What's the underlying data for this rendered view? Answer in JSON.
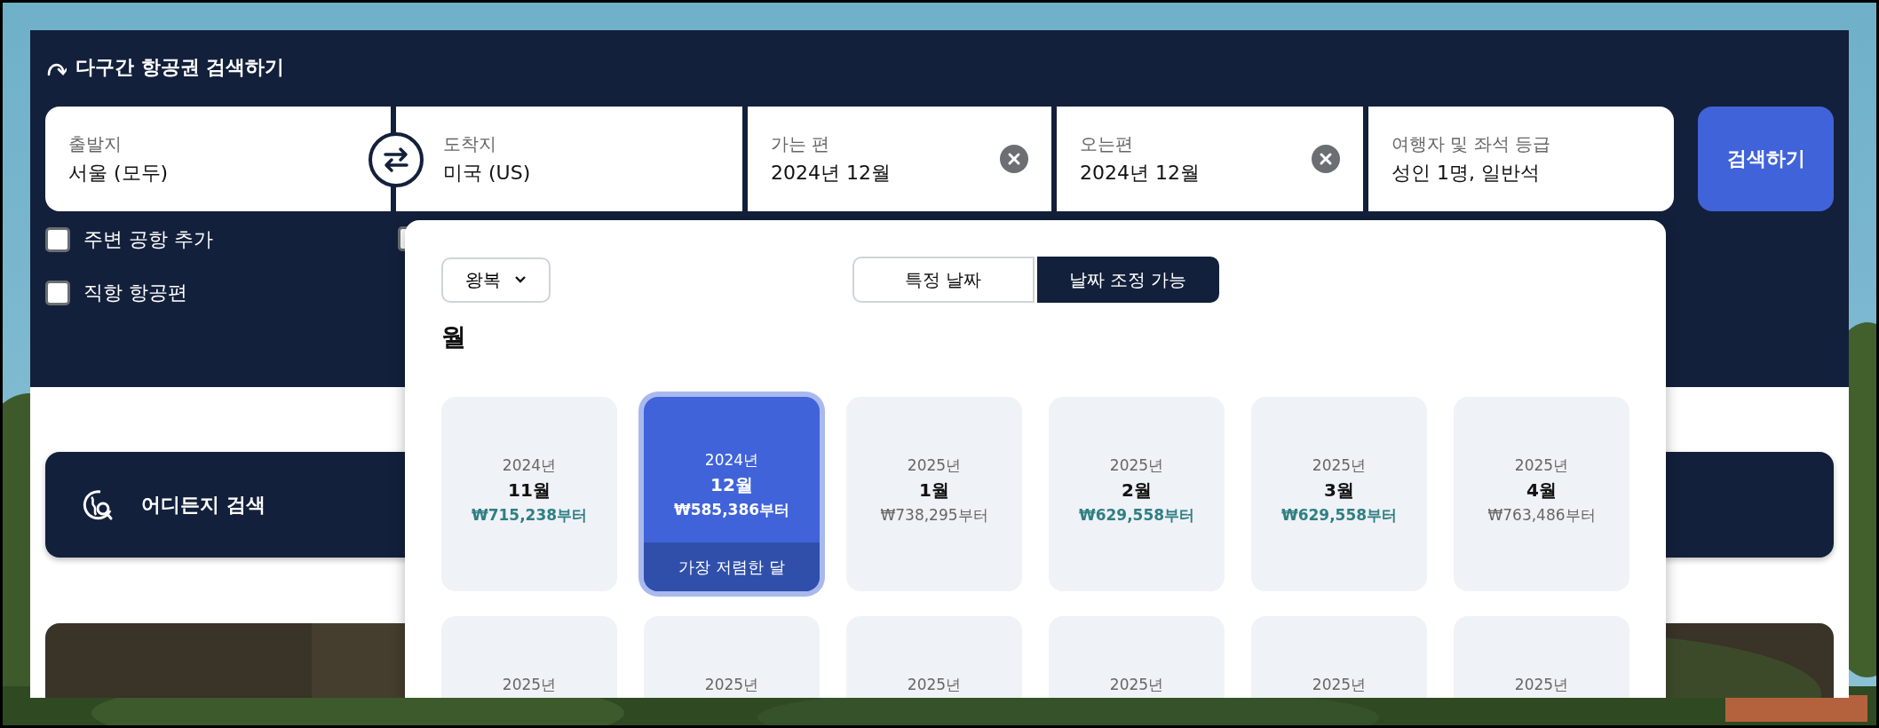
{
  "header": {
    "title": "다구간 항공권 검색하기"
  },
  "fields": [
    {
      "kind": "place",
      "label": "출발지",
      "value": "서울 (모두)"
    },
    {
      "kind": "place",
      "label": "도착지",
      "value": "미국 (US)"
    },
    {
      "kind": "date",
      "label": "가는 편",
      "value": "2024년 12월"
    },
    {
      "kind": "date",
      "label": "오는편",
      "value": "2024년 12월"
    },
    {
      "kind": "travelers",
      "label": "여행자 및 좌석 등급",
      "value": "성인 1명, 일반석"
    }
  ],
  "search_button": "검색하기",
  "checkboxes": [
    {
      "label": "주변 공항 추가",
      "checked": false
    },
    {
      "label": "직항 항공편",
      "checked": false
    },
    {
      "checked": false
    }
  ],
  "anywhere_card": {
    "label": "어디든지 검색"
  },
  "date_popup": {
    "trip_type": "왕복",
    "date_modes": [
      {
        "label": "특정 날짜",
        "selected": false
      },
      {
        "label": "날짜 조정 가능",
        "selected": true
      }
    ],
    "heading": "월",
    "months": [
      {
        "year": "2024년",
        "month": "11월",
        "price": "₩715,238부터",
        "cheap": true,
        "selected": false
      },
      {
        "year": "2024년",
        "month": "12월",
        "price": "₩585,386부터",
        "cheap": false,
        "selected": true,
        "badge": "가장 저렴한 달"
      },
      {
        "year": "2025년",
        "month": "1월",
        "price": "₩738,295부터",
        "cheap": false,
        "selected": false
      },
      {
        "year": "2025년",
        "month": "2월",
        "price": "₩629,558부터",
        "cheap": true,
        "selected": false
      },
      {
        "year": "2025년",
        "month": "3월",
        "price": "₩629,558부터",
        "cheap": true,
        "selected": false
      },
      {
        "year": "2025년",
        "month": "4월",
        "price": "₩763,486부터",
        "cheap": false,
        "selected": false
      },
      {
        "year": "2025년",
        "selected": false
      },
      {
        "year": "2025년",
        "selected": false
      },
      {
        "year": "2025년",
        "selected": false
      },
      {
        "year": "2025년",
        "selected": false
      },
      {
        "year": "2025년",
        "selected": false
      },
      {
        "year": "2025년",
        "selected": false
      }
    ]
  }
}
